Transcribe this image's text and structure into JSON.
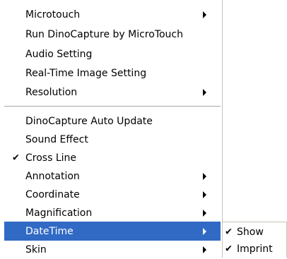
{
  "menu": {
    "items": [
      {
        "label": "Microtouch",
        "submenu": true
      },
      {
        "label": "Run DinoCapture by MicroTouch",
        "submenu": false
      },
      {
        "label": "Audio Setting",
        "submenu": false
      },
      {
        "label": "Real-Time Image Setting",
        "submenu": false
      },
      {
        "label": "Resolution",
        "submenu": true
      },
      {
        "label": "DinoCapture Auto Update",
        "submenu": false
      },
      {
        "label": "Sound Effect",
        "submenu": false
      },
      {
        "label": "Cross Line",
        "submenu": false,
        "checked": true
      },
      {
        "label": "Annotation",
        "submenu": true
      },
      {
        "label": "Coordinate",
        "submenu": true
      },
      {
        "label": "Magnification",
        "submenu": true
      },
      {
        "label": "DateTime",
        "submenu": true,
        "highlighted": true
      },
      {
        "label": "Skin",
        "submenu": true
      }
    ]
  },
  "submenu": {
    "items": [
      {
        "label": "Show",
        "checked": true
      },
      {
        "label": "Imprint",
        "checked": true
      }
    ]
  },
  "colors": {
    "highlight": "#316ac5",
    "highlight_text": "#ffffff",
    "separator": "#a7a7a7"
  },
  "icons": {
    "check": "check-icon",
    "submenu_arrow": "submenu-arrow-icon"
  }
}
